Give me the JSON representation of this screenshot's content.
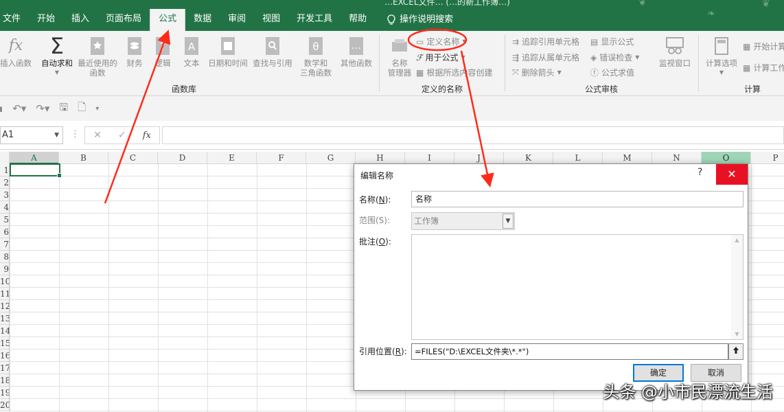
{
  "window": {
    "title_partial": "…EXCEL文件… (…的新工作簿…)"
  },
  "tabs": [
    {
      "label": "文件"
    },
    {
      "label": "开始"
    },
    {
      "label": "插入"
    },
    {
      "label": "页面布局"
    },
    {
      "label": "公式",
      "active": true
    },
    {
      "label": "数据"
    },
    {
      "label": "审阅"
    },
    {
      "label": "视图"
    },
    {
      "label": "开发工具"
    },
    {
      "label": "帮助"
    }
  ],
  "search_tab": {
    "label": "操作说明搜索"
  },
  "ribbon": {
    "function_library": {
      "label": "函数库",
      "insert_function": "插入函数",
      "autosum": "自动求和",
      "recent_line1": "最近使用的",
      "recent_line2": "函数",
      "finance": "财务",
      "logic": "逻辑",
      "text": "文本",
      "datetime": "日期和时间",
      "lookup": "查找与引用",
      "math_line1": "数学和",
      "math_line2": "三角函数",
      "other": "其他函数"
    },
    "defined_names": {
      "label": "定义的名称",
      "name_manager_line1": "名称",
      "name_manager_line2": "管理器",
      "define_name": "定义名称",
      "use_in_formula": "用于公式",
      "create_from_selection": "根据所选内容创建"
    },
    "formula_auditing": {
      "label": "公式审核",
      "trace_precedents": "追踪引用单元格",
      "trace_dependents": "追踪从属单元格",
      "remove_arrows": "删除箭头",
      "show_formulas": "显示公式",
      "error_checking": "错误检查",
      "evaluate_formula": "公式求值",
      "watch_window": "监视窗口"
    },
    "calculation": {
      "label": "计算",
      "calc_options": "计算选项",
      "calc_now": "开始计算",
      "calc_sheet": "计算工作表"
    }
  },
  "formula_bar": {
    "name_box": "A1",
    "fx": "fx",
    "cancel": "✕",
    "enter": "✓",
    "value": ""
  },
  "grid": {
    "columns": [
      "A",
      "B",
      "C",
      "D",
      "E",
      "F",
      "G",
      "H",
      "I",
      "J",
      "K",
      "L",
      "M",
      "N",
      "O",
      "P"
    ],
    "rows": [
      "1",
      "2",
      "3",
      "4",
      "5",
      "6",
      "7",
      "8",
      "9",
      "10",
      "11",
      "12",
      "13",
      "14",
      "15",
      "16",
      "17",
      "18",
      "19",
      "20"
    ],
    "active_cell": "A1"
  },
  "dialog": {
    "title": "编辑名称",
    "help": "?",
    "close": "✕",
    "name_label": "名称(N):",
    "name_label_pre": "名称(",
    "name_label_key": "N",
    "name_label_post": "):",
    "name_value": "名称",
    "scope_label": "范围(S):",
    "scope_value": "工作簿",
    "comment_label_pre": "批注(",
    "comment_label_key": "O",
    "comment_label_post": "):",
    "ref_label_pre": "引用位置(",
    "ref_label_key": "R",
    "ref_label_post": "):",
    "ref_value": "=FILES(\"D:\\EXCEL文件夹\\*.*\")",
    "ok": "确定",
    "cancel": "取消"
  },
  "watermark": "头条 @小市民漂流生活",
  "colors": {
    "excel_green": "#217346",
    "annotation_red": "#ff2a1a",
    "close_red": "#e81123",
    "focus_blue": "#0078d7"
  }
}
